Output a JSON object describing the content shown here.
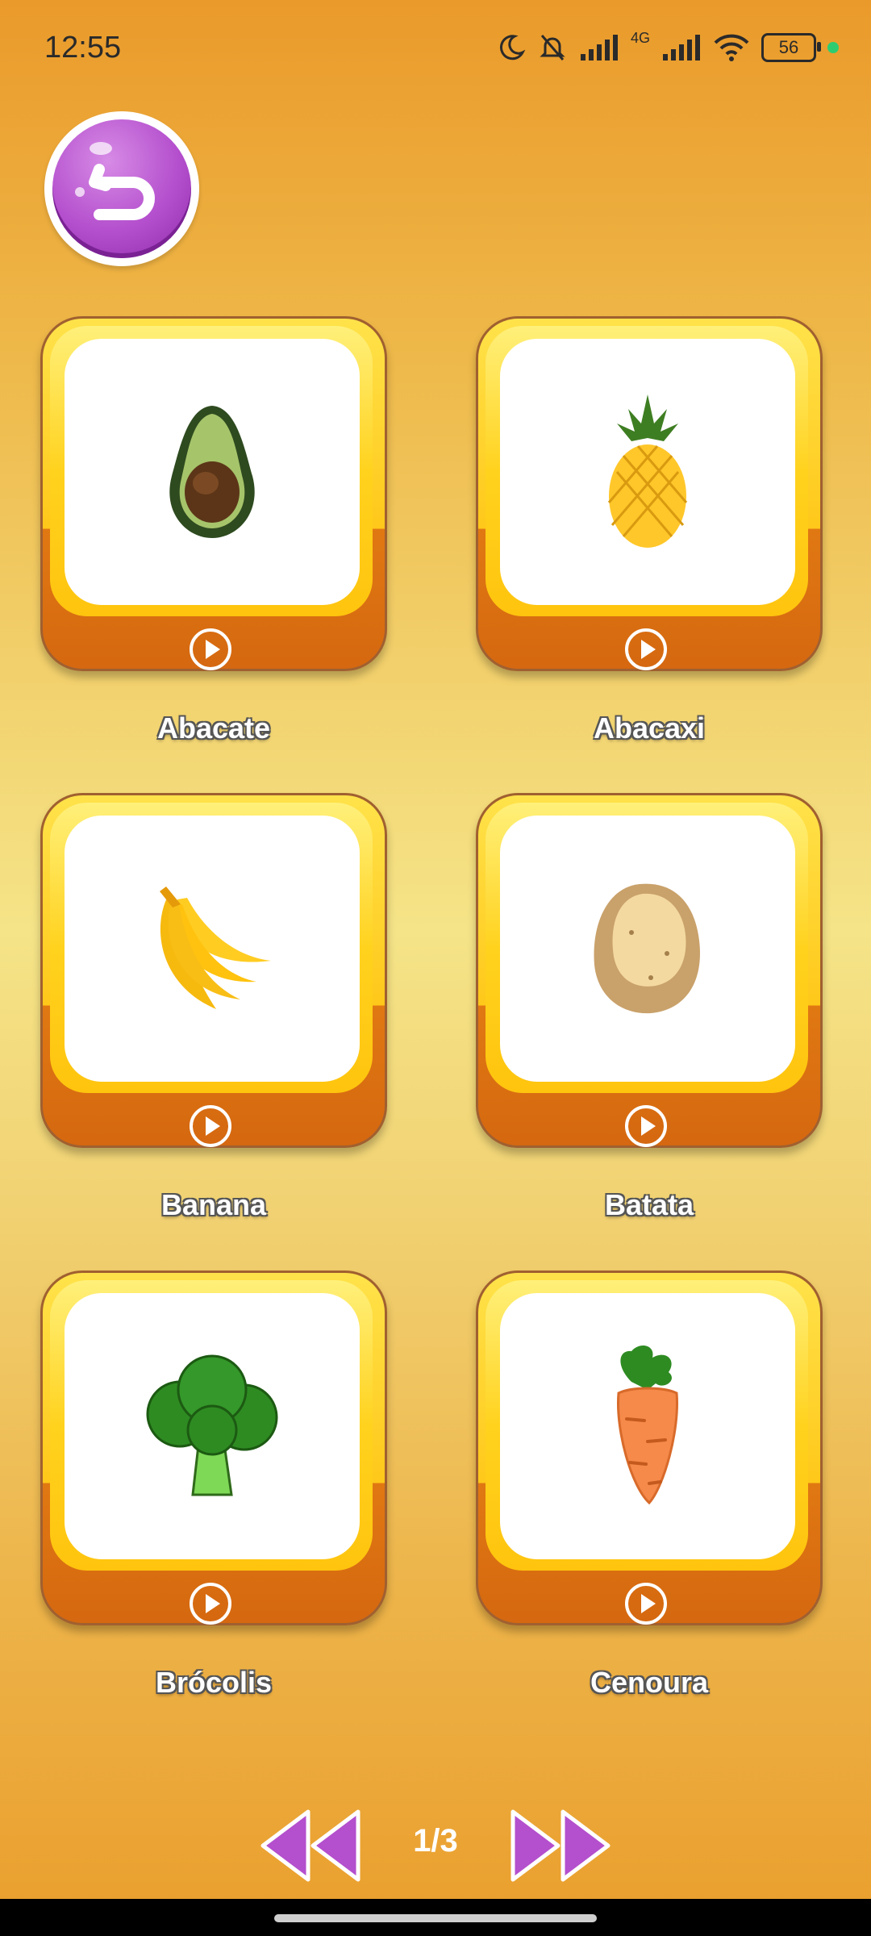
{
  "status_bar": {
    "time": "12:55",
    "network_label": "4G",
    "battery": "56"
  },
  "back_button": {
    "icon": "back-arrow-icon",
    "color": "#B44FCD"
  },
  "cards": [
    {
      "label": "Abacate",
      "icon": "avocado-icon"
    },
    {
      "label": "Abacaxi",
      "icon": "pineapple-icon"
    },
    {
      "label": "Banana",
      "icon": "banana-icon"
    },
    {
      "label": "Batata",
      "icon": "potato-icon"
    },
    {
      "label": "Brócolis",
      "icon": "broccoli-icon"
    },
    {
      "label": "Cenoura",
      "icon": "carrot-icon"
    }
  ],
  "pager": {
    "page_indicator": "1/3",
    "prev_icon": "double-left-arrow-icon",
    "next_icon": "double-right-arrow-icon"
  },
  "colors": {
    "card_orange": "#E07812",
    "card_yellow": "#FFD21E",
    "arrow_purple": "#B44FCD"
  }
}
